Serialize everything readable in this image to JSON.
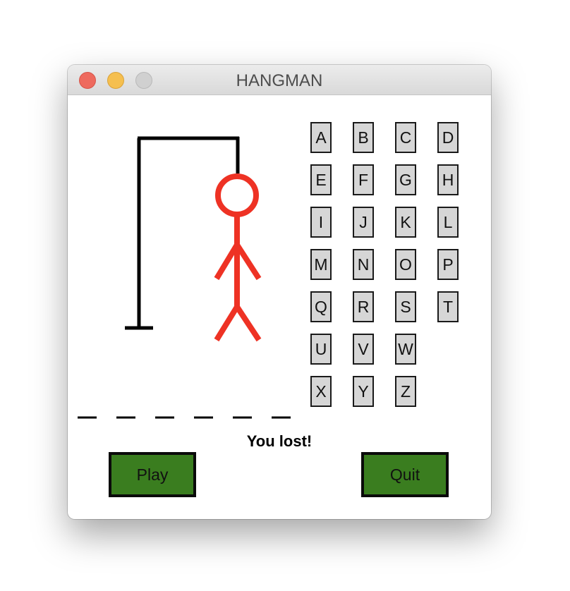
{
  "window": {
    "title": "HANGMAN"
  },
  "colors": {
    "figure": "#ee3224",
    "gallows": "#000000",
    "letter_bg": "#d6d6d6",
    "button_bg": "#3a7d1f"
  },
  "letters": [
    "A",
    "B",
    "C",
    "D",
    "E",
    "F",
    "G",
    "H",
    "I",
    "J",
    "K",
    "L",
    "M",
    "N",
    "O",
    "P",
    "Q",
    "R",
    "S",
    "T",
    "U",
    "V",
    "W",
    "X",
    "Y",
    "Z"
  ],
  "word": {
    "length": 6
  },
  "status": {
    "message": "You lost!"
  },
  "buttons": {
    "play_label": "Play",
    "quit_label": "Quit"
  }
}
